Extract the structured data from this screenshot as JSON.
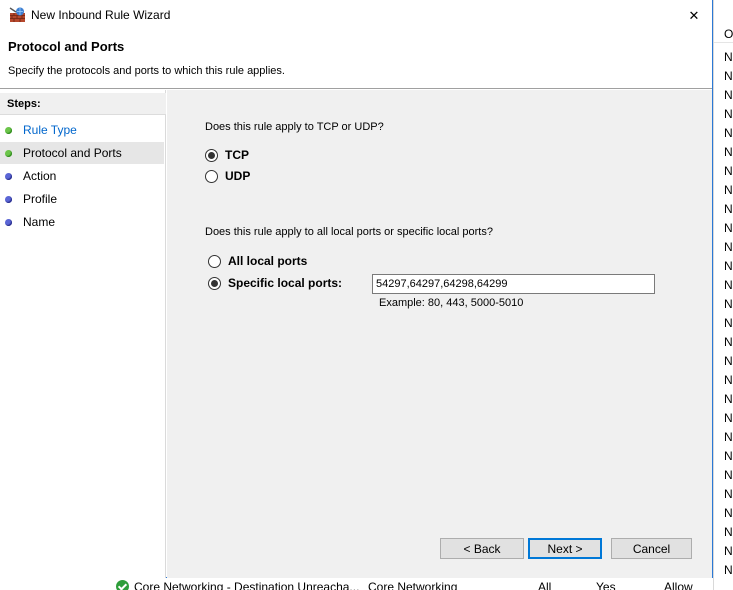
{
  "window": {
    "title": "New Inbound Rule Wizard",
    "close_glyph": "✕",
    "app_icon": "firewall-wizard-icon"
  },
  "header": {
    "title": "Protocol and Ports",
    "subtitle": "Specify the protocols and ports to which this rule applies."
  },
  "steps": {
    "heading": "Steps:",
    "items": [
      {
        "label": "Rule Type",
        "state": "link",
        "dot": "green"
      },
      {
        "label": "Protocol and Ports",
        "state": "current",
        "dot": "green"
      },
      {
        "label": "Action",
        "state": "pending",
        "dot": "blue"
      },
      {
        "label": "Profile",
        "state": "pending",
        "dot": "blue"
      },
      {
        "label": "Name",
        "state": "pending",
        "dot": "blue"
      }
    ]
  },
  "protocol": {
    "question": "Does this rule apply to TCP or UDP?",
    "options": [
      {
        "label": "TCP",
        "checked": true
      },
      {
        "label": "UDP",
        "checked": false
      }
    ]
  },
  "ports": {
    "question": "Does this rule apply to all local ports or specific local ports?",
    "options": [
      {
        "label": "All local ports",
        "checked": false
      },
      {
        "label": "Specific local ports:",
        "checked": true
      }
    ],
    "value": "54297,64297,64298,64299",
    "example": "Example: 80, 443, 5000-5010"
  },
  "buttons": {
    "back": "< Back",
    "next": "Next >",
    "cancel": "Cancel"
  },
  "background": {
    "list_header": "O",
    "list_letter": "N",
    "bottom_row": {
      "name": "Core Networking - Destination Unreacha...",
      "group": "Core Networking",
      "profile": "All",
      "enabled": "Yes",
      "action": "Allow"
    }
  },
  "colors": {
    "accent": "#0078d7",
    "step_link": "#0066cc",
    "step_done": "#6cc54a",
    "step_pending": "#5b66d6",
    "content_bg": "#f0f0f0"
  }
}
